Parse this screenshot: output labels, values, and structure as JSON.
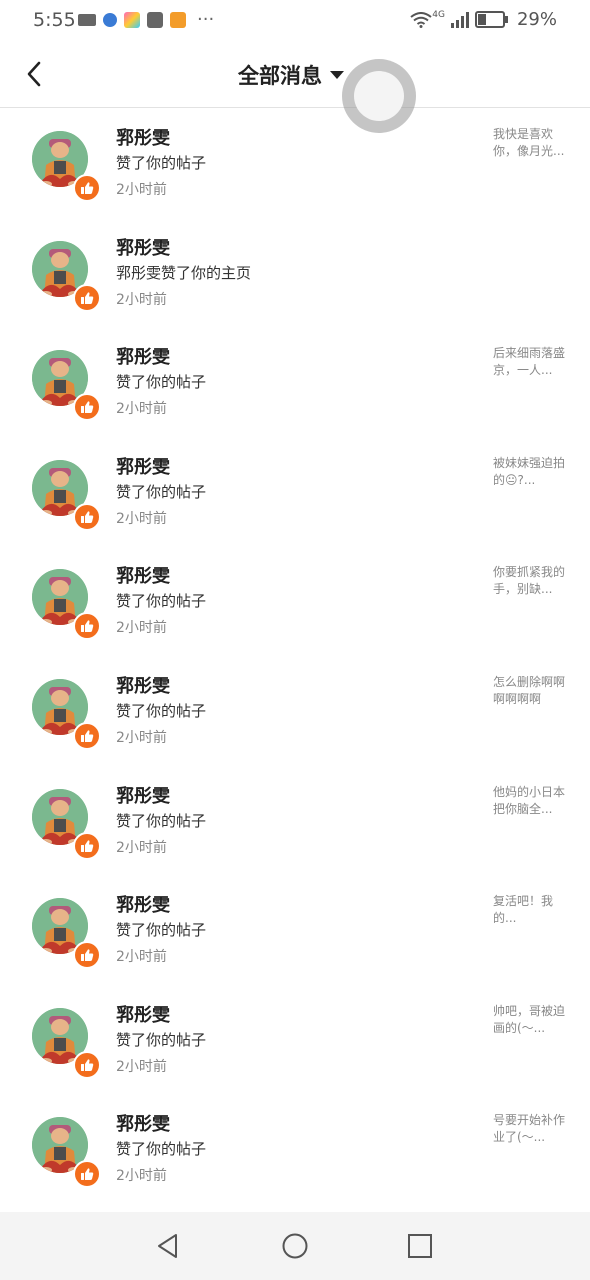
{
  "status_bar": {
    "time": "5:55",
    "battery": "29%",
    "signal_label": "4G"
  },
  "header": {
    "title": "全部消息"
  },
  "notifications": [
    {
      "name": "郛彤雯",
      "action": "赞了你的帖子",
      "time": "2小时前",
      "preview": "我快是喜欢你，像月光..."
    },
    {
      "name": "郛彤雯",
      "action": "郛彤雯赞了你的主页",
      "time": "2小时前",
      "preview": ""
    },
    {
      "name": "郛彤雯",
      "action": "赞了你的帖子",
      "time": "2小时前",
      "preview": "后来细雨落盛京，一人..."
    },
    {
      "name": "郛彤雯",
      "action": "赞了你的帖子",
      "time": "2小时前",
      "preview": "被妹妹强迫拍的😐?..."
    },
    {
      "name": "郛彤雯",
      "action": "赞了你的帖子",
      "time": "2小时前",
      "preview": "你要抓紧我的手，别缺..."
    },
    {
      "name": "郛彤雯",
      "action": "赞了你的帖子",
      "time": "2小时前",
      "preview": "怎么删除啊啊啊啊啊啊"
    },
    {
      "name": "郛彤雯",
      "action": "赞了你的帖子",
      "time": "2小时前",
      "preview": "他妈的小日本把你脑全..."
    },
    {
      "name": "郛彤雯",
      "action": "赞了你的帖子",
      "time": "2小时前",
      "preview": "复活吧！我的..."
    },
    {
      "name": "郛彤雯",
      "action": "赞了你的帖子",
      "time": "2小时前",
      "preview": "帅吧，哥被迫画的(～..."
    },
    {
      "name": "郛彤雯",
      "action": "赞了你的帖子",
      "time": "2小时前",
      "preview": "号要开始补作业了(～..."
    }
  ],
  "colors": {
    "accent": "#f36d1c",
    "avatar_bg": "#7bb88f"
  }
}
